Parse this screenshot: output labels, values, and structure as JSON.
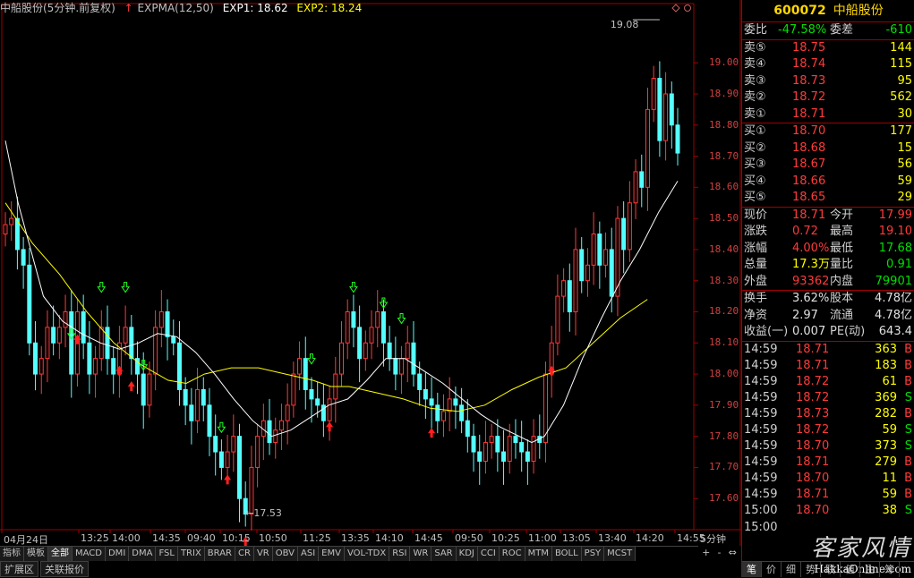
{
  "header": {
    "title": "中船股份(5分钟.前复权)",
    "indicator": "EXPMA(12,50)",
    "exp1": "EXP1: 18.62",
    "exp2": "EXP2: 18.24",
    "colors": {
      "exp1": "#ffffff",
      "exp2": "#ffff00"
    }
  },
  "chart_data": {
    "type": "candlestick",
    "ylim": [
      17.5,
      19.15
    ],
    "y_ticks": [
      "19.00",
      "18.90",
      "18.80",
      "18.70",
      "18.60",
      "18.50",
      "18.40",
      "18.30",
      "18.20",
      "18.10",
      "18.00",
      "17.90",
      "17.80",
      "17.70",
      "17.60"
    ],
    "x_ticks": [
      "04月24日",
      "13:25",
      "14:00",
      "14:35",
      "09:40",
      "10:15",
      "10:50",
      "11:25",
      "13:35",
      "14:10",
      "14:45",
      "09:50",
      "10:25",
      "11:00",
      "13:05",
      "13:40",
      "14:20",
      "14:55"
    ],
    "annotations": {
      "high": "19.08",
      "low": "←17.53"
    },
    "closes": [
      18.48,
      18.5,
      18.4,
      18.35,
      18.1,
      18.0,
      18.05,
      18.15,
      18.1,
      18.15,
      18.2,
      18.0,
      18.2,
      18.1,
      18.0,
      18.05,
      18.15,
      18.05,
      18.0,
      18.1,
      18.15,
      18.05,
      18.0,
      17.9,
      18.0,
      18.15,
      18.2,
      18.12,
      18.1,
      17.95,
      17.9,
      17.85,
      17.95,
      17.9,
      17.8,
      17.75,
      17.7,
      17.75,
      17.8,
      17.6,
      17.55,
      17.7,
      17.8,
      17.85,
      17.78,
      17.82,
      17.85,
      17.9,
      18.0,
      18.05,
      17.95,
      17.92,
      17.9,
      17.85,
      17.92,
      18.0,
      18.1,
      18.2,
      18.15,
      18.05,
      18.1,
      18.15,
      18.2,
      18.1,
      18.05,
      18.0,
      18.05,
      18.1,
      18.0,
      17.95,
      17.92,
      17.9,
      17.85,
      17.88,
      17.92,
      17.9,
      17.85,
      17.8,
      17.75,
      17.72,
      17.78,
      17.8,
      17.75,
      17.72,
      17.8,
      17.78,
      17.75,
      17.72,
      17.8,
      17.78,
      18.0,
      18.1,
      18.25,
      18.3,
      18.2,
      18.4,
      18.3,
      18.35,
      18.45,
      18.35,
      18.4,
      18.25,
      18.5,
      18.4,
      18.55,
      18.65,
      18.6,
      18.85,
      18.95,
      18.75,
      18.9,
      18.8,
      18.71
    ],
    "series": [
      {
        "name": "EXP1",
        "color": "#ffffff"
      },
      {
        "name": "EXP2",
        "color": "#ffff00"
      }
    ],
    "exp2_points": [
      [
        0,
        18.55
      ],
      [
        15,
        18.42
      ],
      [
        30,
        18.32
      ],
      [
        45,
        18.2
      ],
      [
        60,
        18.1
      ],
      [
        75,
        18.03
      ],
      [
        90,
        17.98
      ],
      [
        100,
        17.97
      ],
      [
        110,
        18.0
      ],
      [
        125,
        18.02
      ],
      [
        140,
        18.02
      ],
      [
        155,
        18.0
      ],
      [
        170,
        17.98
      ],
      [
        180,
        17.96
      ],
      [
        190,
        17.96
      ],
      [
        205,
        17.94
      ],
      [
        220,
        17.92
      ],
      [
        235,
        17.89
      ],
      [
        250,
        17.88
      ],
      [
        265,
        17.9
      ],
      [
        280,
        17.95
      ],
      [
        295,
        17.99
      ],
      [
        310,
        18.02
      ],
      [
        325,
        18.1
      ],
      [
        340,
        18.18
      ],
      [
        355,
        18.24
      ]
    ],
    "exp1_points": [
      [
        0,
        18.75
      ],
      [
        10,
        18.55
      ],
      [
        20,
        18.4
      ],
      [
        30,
        18.25
      ],
      [
        45,
        18.17
      ],
      [
        60,
        18.13
      ],
      [
        75,
        18.1
      ],
      [
        90,
        18.08
      ],
      [
        105,
        18.1
      ],
      [
        120,
        18.13
      ],
      [
        135,
        18.12
      ],
      [
        150,
        18.07
      ],
      [
        165,
        18.0
      ],
      [
        180,
        17.92
      ],
      [
        195,
        17.85
      ],
      [
        210,
        17.8
      ],
      [
        225,
        17.82
      ],
      [
        240,
        17.86
      ],
      [
        255,
        17.9
      ],
      [
        270,
        17.92
      ],
      [
        285,
        17.98
      ],
      [
        300,
        18.05
      ],
      [
        315,
        18.05
      ],
      [
        330,
        18.01
      ],
      [
        345,
        17.97
      ],
      [
        360,
        17.92
      ],
      [
        375,
        17.87
      ],
      [
        390,
        17.83
      ],
      [
        405,
        17.8
      ],
      [
        415,
        17.78
      ],
      [
        425,
        17.8
      ],
      [
        440,
        17.9
      ],
      [
        455,
        18.05
      ],
      [
        470,
        18.18
      ],
      [
        485,
        18.3
      ],
      [
        500,
        18.4
      ],
      [
        515,
        18.52
      ],
      [
        530,
        18.62
      ]
    ],
    "buy_signals_at": [
      12,
      19,
      21,
      37,
      40,
      54,
      71,
      91
    ],
    "sell_signals_at": [
      11,
      16,
      20,
      23,
      36,
      51,
      58,
      63,
      66
    ]
  },
  "bottom": {
    "indicator_tabs": [
      "指标",
      "模板",
      "全部",
      "MACD",
      "DMI",
      "DMA",
      "FSL",
      "TRIX",
      "BRAR",
      "CR",
      "VR",
      "OBV",
      "ASI",
      "EMV",
      "VOL-TDX",
      "RSI",
      "WR",
      "SAR",
      "KDJ",
      "CCI",
      "ROC",
      "MTM",
      "BOLL",
      "PSY",
      "MCST"
    ],
    "selected_tab": "全部",
    "tabs2": [
      "扩展区",
      "关联报价"
    ],
    "period": "5分钟",
    "scroll": [
      "+",
      "-",
      "⇔"
    ]
  },
  "panel": {
    "code": "600072",
    "name": "中船股份",
    "weibi_label": "委比",
    "weibi": "-47.58%",
    "weicha_label": "委差",
    "weicha": "-610",
    "asks": [
      {
        "label": "卖⑤",
        "price": "18.75",
        "vol": "144"
      },
      {
        "label": "卖④",
        "price": "18.74",
        "vol": "115"
      },
      {
        "label": "卖③",
        "price": "18.73",
        "vol": "95"
      },
      {
        "label": "卖②",
        "price": "18.72",
        "vol": "562"
      },
      {
        "label": "卖①",
        "price": "18.71",
        "vol": "30"
      }
    ],
    "bids": [
      {
        "label": "买①",
        "price": "18.70",
        "vol": "177"
      },
      {
        "label": "买②",
        "price": "18.68",
        "vol": "15"
      },
      {
        "label": "买③",
        "price": "18.67",
        "vol": "56"
      },
      {
        "label": "买④",
        "price": "18.66",
        "vol": "59"
      },
      {
        "label": "买⑤",
        "price": "18.65",
        "vol": "29"
      }
    ],
    "quote": [
      {
        "l": "现价",
        "v": "18.71",
        "l2": "今开",
        "v2": "17.99",
        "c": "red",
        "c2": "red"
      },
      {
        "l": "涨跌",
        "v": "0.72",
        "l2": "最高",
        "v2": "19.10",
        "c": "red",
        "c2": "red"
      },
      {
        "l": "涨幅",
        "v": "4.00%",
        "l2": "最低",
        "v2": "17.68",
        "c": "red",
        "c2": "grn"
      },
      {
        "l": "总量",
        "v": "17.3万",
        "l2": "量比",
        "v2": "0.91",
        "c": "yel",
        "c2": "grn"
      },
      {
        "l": "外盘",
        "v": "93362",
        "l2": "内盘",
        "v2": "79901",
        "c": "red",
        "c2": "grn"
      }
    ],
    "finance": [
      {
        "l": "换手",
        "v": "3.62%",
        "l2": "股本",
        "v2": "4.78亿"
      },
      {
        "l": "净资",
        "v": "2.97",
        "l2": "流通",
        "v2": "4.78亿"
      },
      {
        "l": "收益(一)",
        "v": "0.007",
        "l2": "PE(动)",
        "v2": "643.4"
      }
    ],
    "ticks": [
      {
        "t": "14:59",
        "p": "18.71",
        "q": "363",
        "s": "B"
      },
      {
        "t": "14:59",
        "p": "18.71",
        "q": "183",
        "s": "B"
      },
      {
        "t": "14:59",
        "p": "18.72",
        "q": "61",
        "s": "B"
      },
      {
        "t": "14:59",
        "p": "18.72",
        "q": "369",
        "s": "S"
      },
      {
        "t": "14:59",
        "p": "18.73",
        "q": "282",
        "s": "B"
      },
      {
        "t": "14:59",
        "p": "18.72",
        "q": "59",
        "s": "S"
      },
      {
        "t": "14:59",
        "p": "18.70",
        "q": "373",
        "s": "S"
      },
      {
        "t": "14:59",
        "p": "18.71",
        "q": "279",
        "s": "B"
      },
      {
        "t": "14:59",
        "p": "18.70",
        "q": "11",
        "s": "B"
      },
      {
        "t": "14:59",
        "p": "18.71",
        "q": "59",
        "s": "B"
      },
      {
        "t": "15:00",
        "p": "18.70",
        "q": "38",
        "s": "S"
      },
      {
        "t": "15:00",
        "p": "",
        "q": "",
        "s": ""
      }
    ],
    "bottom_tabs": [
      "笔",
      "价",
      "细",
      "势",
      "联",
      "值",
      "主",
      "筹"
    ],
    "watermark": "客家风情",
    "watermark_url": "HakkaOnline.com"
  }
}
